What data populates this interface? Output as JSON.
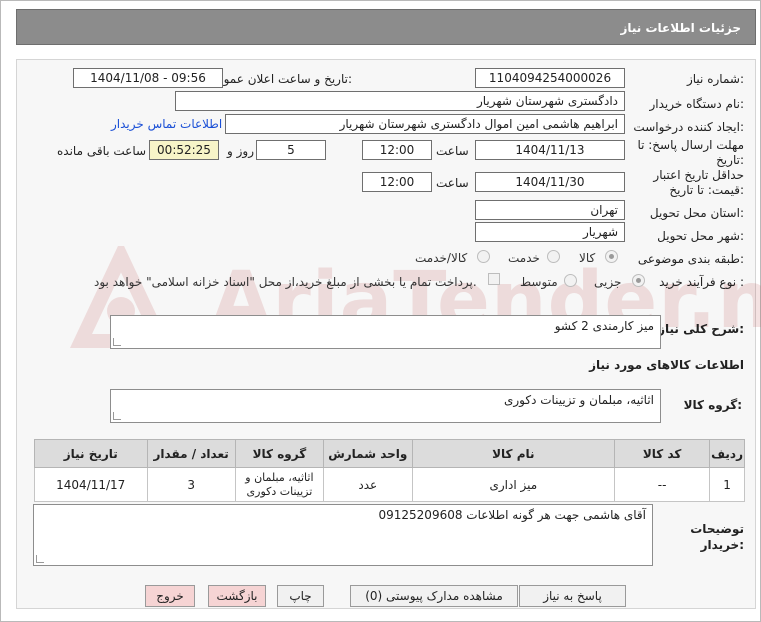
{
  "header": {
    "title": "جزئیات اطلاعات نیاز"
  },
  "form": {
    "need_number_label": "شماره نیاز:",
    "need_number": "1104094254000026",
    "announce_label": "تاریخ و ساعت اعلان عمومی:",
    "announce_value": "1404/11/08 - 09:56",
    "buyer_org_label": "نام دستگاه خریدار:",
    "buyer_org": "دادگستری شهرستان شهریار",
    "creator_label": "ایجاد کننده درخواست:",
    "creator": "ابراهیم هاشمی امین اموال دادگستری شهرستان شهریار",
    "contact_link": "اطلاعات تماس خریدار",
    "deadline_label_1": "مهلت ارسال پاسخ: تا",
    "deadline_label_2": "تاریخ:",
    "deadline_date": "1404/11/13",
    "time_label": "ساعت",
    "deadline_time": "12:00",
    "days_value": "5",
    "days_label": "روز و",
    "remaining_time": "00:52:25",
    "remaining_label": "ساعت باقی مانده",
    "validity_label_1": "حداقل تاریخ اعتبار",
    "validity_label_2": "قیمت: تا تاریخ:",
    "validity_date": "1404/11/30",
    "validity_time_label": "ساعت",
    "validity_time": "12:00",
    "province_label": "استان محل تحویل:",
    "province": "تهران",
    "city_label": "شهر محل تحویل:",
    "city": "شهریار",
    "category_label": "طبقه بندی موضوعی:",
    "category_options": [
      "کالا",
      "خدمت",
      "کالا/خدمت"
    ],
    "process_label": "نوع فرآیند خرید :",
    "process_options": [
      "جزیی",
      "متوسط"
    ],
    "payment_text": "پرداخت تمام یا بخشی از مبلغ خرید،از محل \"اسناد خزانه اسلامی\" خواهد بود."
  },
  "summary": {
    "label": "شرح کلی نیاز:",
    "value": "میز کارمندی 2 کشو"
  },
  "goods_section": {
    "title": "اطلاعات کالاهای مورد نیاز",
    "group_label": "گروه کالا:",
    "group_value": "اثاثیه، مبلمان و تزیینات دکوری"
  },
  "table": {
    "headers": [
      "ردیف",
      "کد کالا",
      "نام کالا",
      "واحد شمارش",
      "گروه کالا",
      "تعداد / مقدار",
      "تاریخ نیاز"
    ],
    "rows": [
      [
        "1",
        "--",
        "میز اداری",
        "عدد",
        "اثاثیه، مبلمان و تزیینات دکوری",
        "3",
        "1404/11/17"
      ]
    ]
  },
  "notes": {
    "label_1": "توضیحات",
    "label_2": "خریدار:",
    "value": "09125209608 آقای هاشمی جهت هر گونه اطلاعات"
  },
  "buttons": {
    "reply": "پاسخ به نیاز",
    "docs": "مشاهده مدارک پیوستی (0)",
    "print": "چاپ",
    "back": "بازگشت",
    "exit": "خروج"
  },
  "watermark": {
    "text": "AriaTender.neT"
  }
}
